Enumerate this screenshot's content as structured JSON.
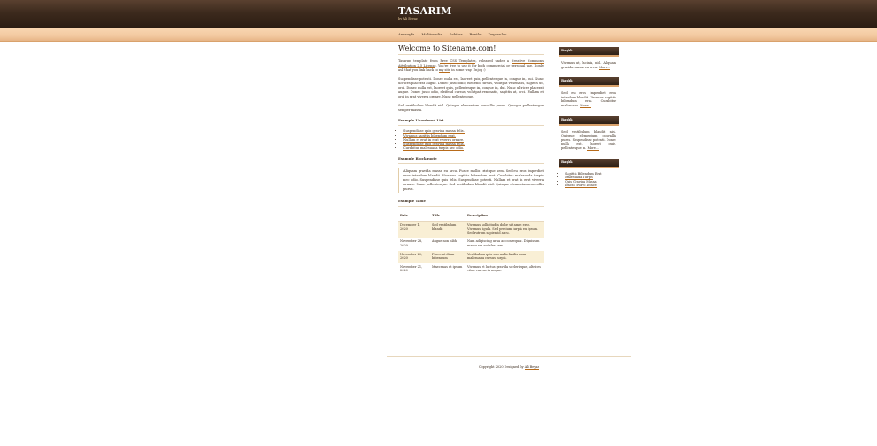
{
  "header": {
    "title": "TASARIM",
    "subtitle": "by Ali Beyaz"
  },
  "nav": [
    "Anasayfa",
    "Multimedia",
    "Sektler",
    "Bentle",
    "Duyurular"
  ],
  "main": {
    "heading": "Welcome to Sitename.com!",
    "intro": {
      "p1": "Tasarım template from ",
      "link1": "Free CSS Templates",
      "p2": ", released under a ",
      "link2": "Creative Commons Attribution 2.5 License",
      "p3": ". You're free to use it for both commercial or personal use. I only ask that you link back to ",
      "link3": "my site",
      "p4": " in some way. Enjoy :)"
    },
    "para2": "Suspendisse potenti. Donec nulla est, laoreet quis, pellentesque in, congue in, dui. Nunc ultrices placerat augue. Donec justo odio, eleifend cursus, volutpat venenatis, sagittis ut, orci. Donec nulla est, laoreet quis, pellentesque in, congue in, dui. Nunc ultrices placerat augue. Donec justo odio, eleifend cursus, volutpat venenatis, sagittis ut, orci. Nullam et orci in erat viverra ornare. Nunc pellentesque.",
    "para3": "Sed vestibulum blandit nisl. Quisque elementum convallis purus. Quisque pellentesque semper massa.",
    "list_heading": "Example Unordered List",
    "list_items": [
      "Suspendisse quis gravida massa felis.",
      "Vivamus sagittis bibendum erat.",
      "Nullam et erat in erat viverra ornare.",
      "Suspendisse quis gravida massa felis.",
      "Curabitur malesuada turpis nec odio."
    ],
    "blockquote_heading": "Example Blockquote",
    "blockquote": "Aliquam gravida massa eu arcu. Fusce mollis tristique sem. Sed eu eros imperdiet eros interdum blandit. Vivamus sagittis bibendum erat. Curabitur malesuada turpis nec odio. Suspendisse quis felis. Suspendisse potenti. Nullam et erat in erat viverra ornare. Nunc pellentesque. Sed vestibulum blandit nisl. Quisque elementum convallis purus.",
    "table_heading": "Example Table",
    "table": {
      "headers": [
        "Date",
        "Title",
        "Description"
      ],
      "rows": [
        [
          "December 1, 2020",
          "Sed vestibulum blandit",
          "Vivamus sollicitudin dolor sit amet eros. Vivamus ligula. Sed pretium turpis eu ipsum. Sed rutrum sapien id arcu."
        ],
        [
          "November 28, 2020",
          "Augue non nibh",
          "Nam adipiscing urna ac consequat. Dignissim massa vel sodales sem."
        ],
        [
          "November 20, 2020",
          "Fusce ut diam bibendum",
          "Vestibulum quis urn nulla facilis nam malesuada cursus turpis."
        ],
        [
          "November 21, 2020",
          "Maecenas et ipsum",
          "Vivamus et luctus gravida scelerisque, ultrices vitae cursus in neque."
        ]
      ]
    }
  },
  "sidebar": {
    "boxes": [
      {
        "title": "Başlık",
        "text": "Vivamus ut, lacinia, nisl. Aliquam gravida massa eu arcu. ",
        "more": "More..."
      },
      {
        "title": "Başlık",
        "text": "Sed eu eros imperdiet eros interdum blandit. Vivamus sagittis bibendum erat. Curabitur malesuada. ",
        "more": "More..."
      },
      {
        "title": "Başlık",
        "text": "Sed vestibulum blandit nisl. Quisque elementum convallis purus. Suspendisse potenti. Donec nulla est, laoreet quis, pellentesque in. ",
        "more": "More..."
      }
    ],
    "link_box": {
      "title": "Başlık",
      "items": [
        "Sagittis Bibendum Erat",
        "Malesuada Turpis",
        "Quis Gravida Massa",
        "Inacsi Vivavo Donce"
      ]
    }
  },
  "footer": {
    "text": "Copyright 2020 Designed by ",
    "link": "Ali Beyaz"
  },
  "colors": {
    "accent": "#b86b1a",
    "header_dark": "#2a1c12",
    "nav_light": "#f3c9a1",
    "row_alt": "#f9efd5"
  }
}
